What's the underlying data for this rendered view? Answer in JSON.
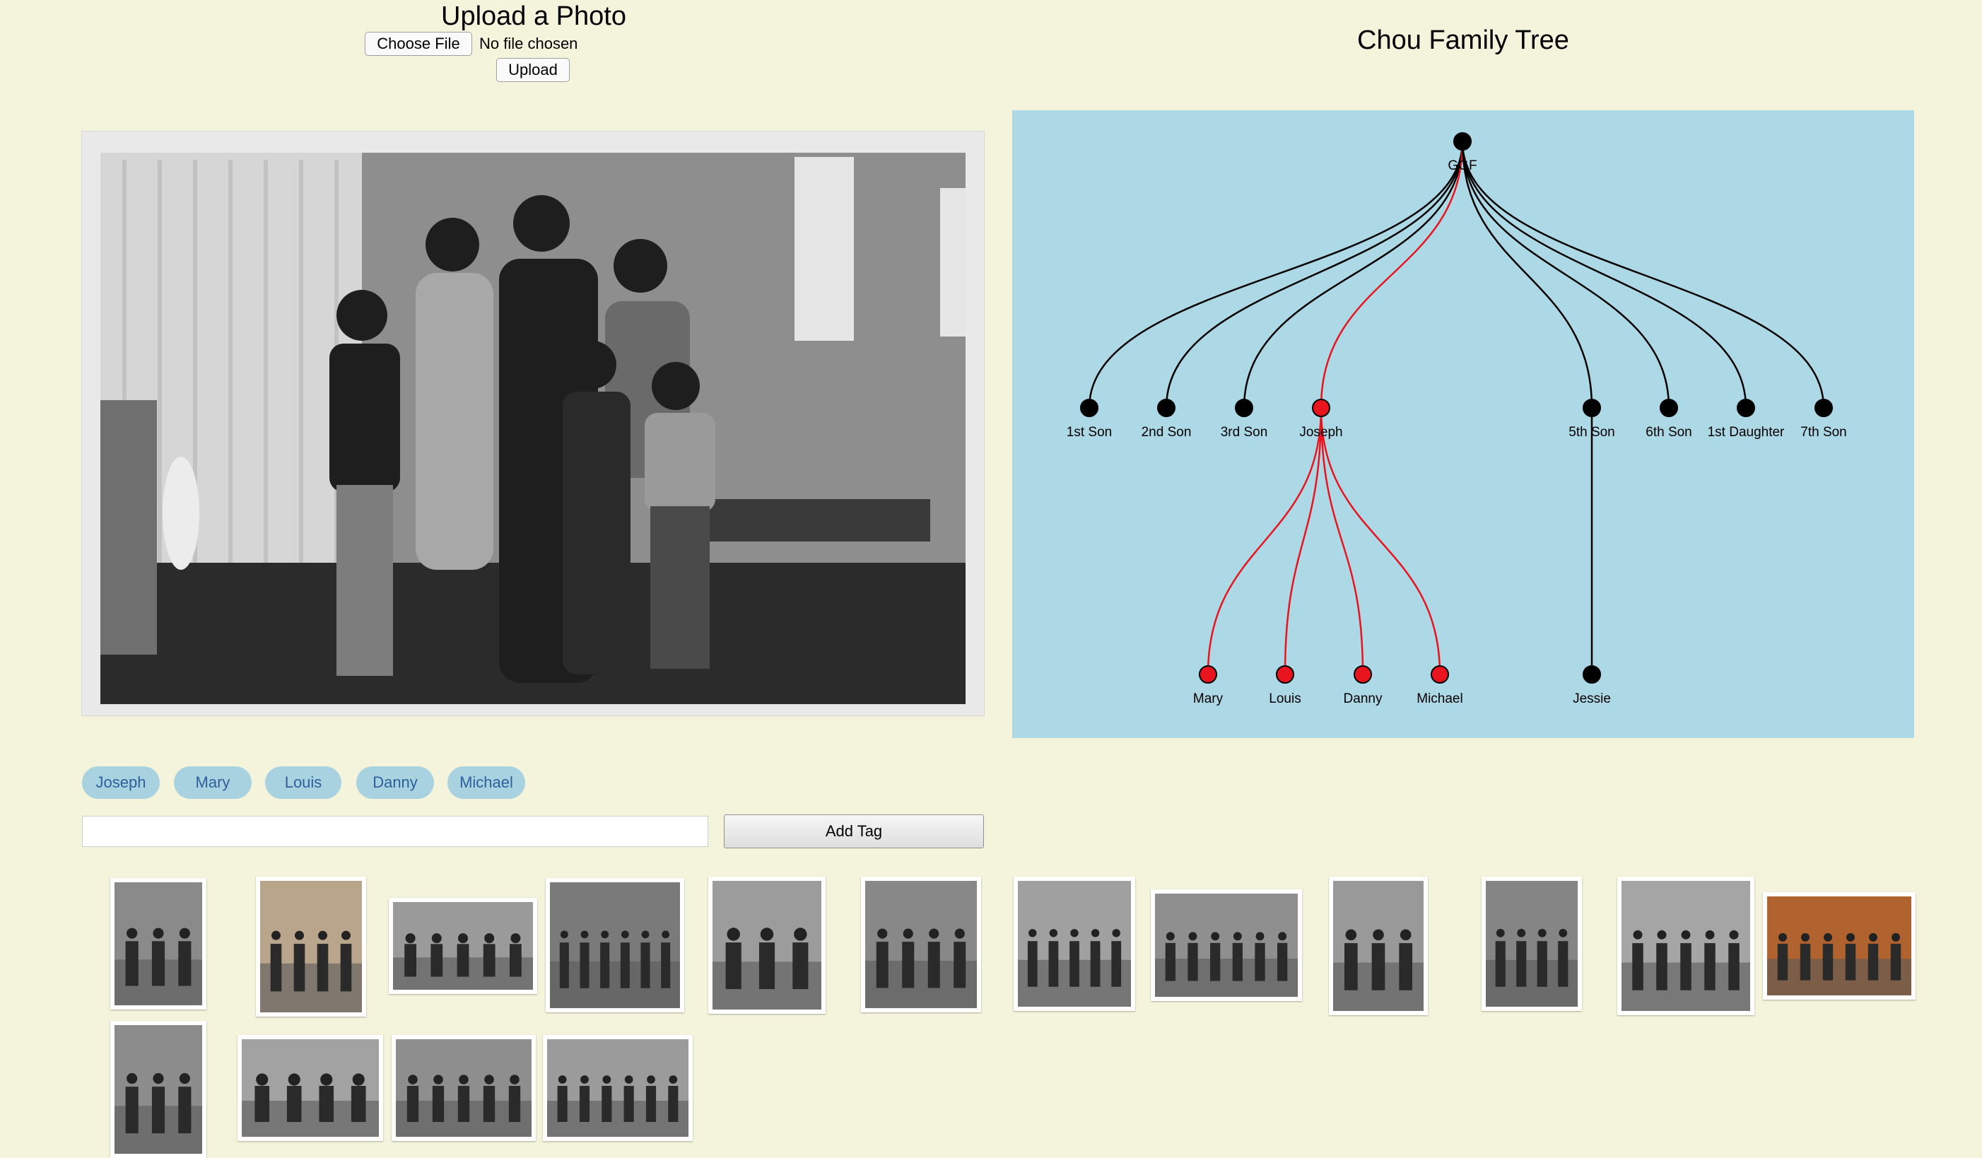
{
  "upload": {
    "title": "Upload a Photo",
    "choose_file_label": "Choose File",
    "file_status": "No file chosen",
    "upload_label": "Upload"
  },
  "tree": {
    "title": "Chou Family Tree",
    "root": "GGF",
    "children": [
      "1st Son",
      "2nd Son",
      "3rd Son",
      "Joseph",
      "5th Son",
      "6th Son",
      "1st Daughter",
      "7th Son"
    ],
    "grandchildren": [
      "Mary",
      "Louis",
      "Danny",
      "Michael",
      "Jessie"
    ],
    "highlight_color": "#e8141e",
    "node_color": "#000000",
    "panel_color": "#add8e6"
  },
  "tags": [
    "Joseph",
    "Mary",
    "Louis",
    "Danny",
    "Michael"
  ],
  "tag_input": {
    "value": "",
    "add_label": "Add Tag"
  },
  "main_photo_icon": "family-photo",
  "thumbnail_count": 17
}
